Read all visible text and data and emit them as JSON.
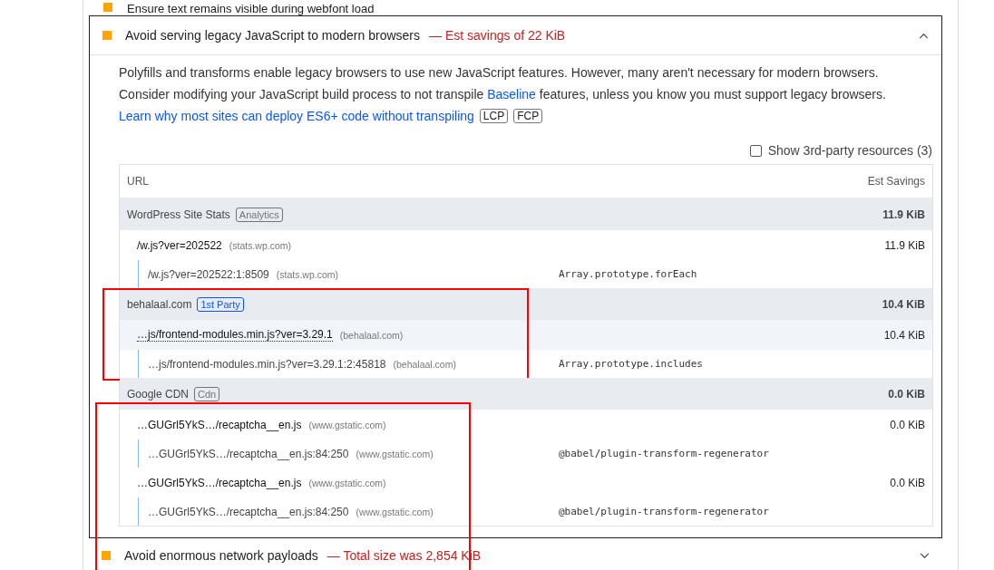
{
  "previous_audit": {
    "title": "Ensure text remains visible during webfont load"
  },
  "audit": {
    "title": "Avoid serving legacy JavaScript to modern browsers",
    "detail": "— Est savings of 22 KiB",
    "expanded": true,
    "description_start": "Polyfills and transforms enable legacy browsers to use new JavaScript features. However, many aren't necessary for modern browsers. Consider modifying your JavaScript build process to not transpile ",
    "description_link": "Baseline",
    "description_end": " features, unless you know you must support legacy browsers.",
    "learn_more_link": "Learn why most sites can deploy ES6+ code without transpiling",
    "metric_tags": [
      "LCP",
      "FCP"
    ],
    "third_party_toggle": {
      "label": "Show 3rd-party resources (3)",
      "checked": false
    },
    "table": {
      "columns": [
        "URL",
        "Est Savings"
      ],
      "groups": [
        {
          "entity": "WordPress Site Stats",
          "tag": "Analytics",
          "color": "#757575",
          "savings": "11.9 KiB",
          "highlighted": false,
          "items": [
            {
              "url": "/w.js?ver=202522",
              "domain": "(stats.wp.com)",
              "savings": "11.9 KiB",
              "hovered": false,
              "subitems": [
                {
                  "location": "/w.js?ver=202522:1:8509",
                  "domain": "(stats.wp.com)",
                  "signal": "Array.prototype.forEach"
                }
              ]
            }
          ]
        },
        {
          "entity": "behalaal.com",
          "tag": "1st Party",
          "color": "#0b57f5",
          "savings": "10.4 KiB",
          "highlighted": true,
          "items": [
            {
              "url": "…js/frontend-modules.min.js?ver=3.29.1",
              "domain": "(behalaal.com)",
              "savings": "10.4 KiB",
              "hovered": true,
              "subitems": [
                {
                  "location": "…js/frontend-modules.min.js?ver=3.29.1:2:45818",
                  "domain": "(behalaal.com)",
                  "signal": "Array.prototype.includes"
                }
              ]
            }
          ]
        },
        {
          "entity": "Google CDN",
          "tag": "Cdn",
          "color": "#757575",
          "savings": "0.0 KiB",
          "highlighted": true,
          "items": [
            {
              "url": "…GUGrl5YkS…/recaptcha__en.js",
              "domain": "(www.gstatic.com)",
              "savings": "0.0 KiB",
              "hovered": false,
              "subitems": [
                {
                  "location": "…GUGrl5YkS…/recaptcha__en.js:84:250",
                  "domain": "(www.gstatic.com)",
                  "signal": "@babel/plugin-transform-regenerator"
                }
              ]
            },
            {
              "url": "…GUGrl5YkS…/recaptcha__en.js",
              "domain": "(www.gstatic.com)",
              "savings": "0.0 KiB",
              "hovered": false,
              "subitems": [
                {
                  "location": "…GUGrl5YkS…/recaptcha__en.js:84:250",
                  "domain": "(www.gstatic.com)",
                  "signal": "@babel/plugin-transform-regenerator"
                }
              ]
            }
          ]
        }
      ]
    }
  },
  "next_audit": {
    "title": "Avoid enormous network payloads",
    "detail": "— Total size was 2,854 KiB",
    "expanded": false
  }
}
